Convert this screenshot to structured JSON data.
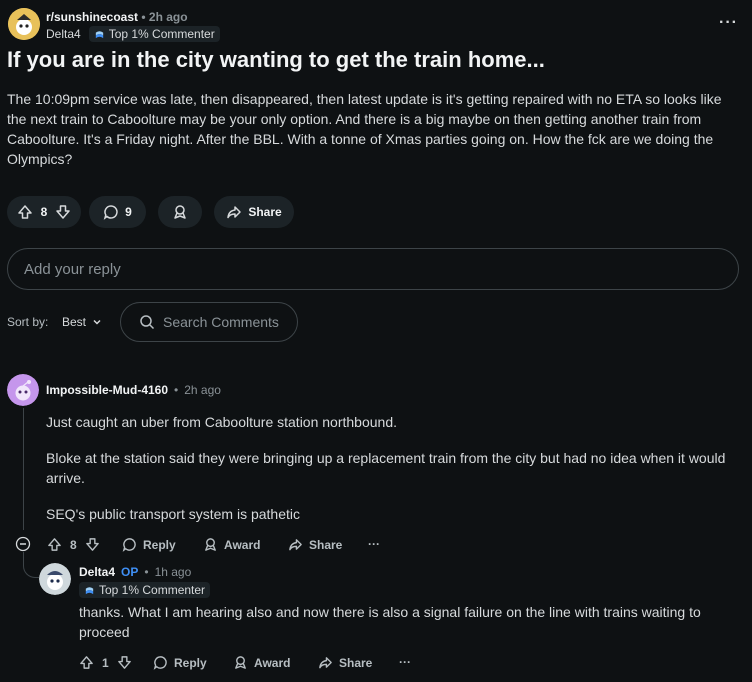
{
  "post": {
    "subreddit": "r/sunshinecoast",
    "separator": "•",
    "time": "2h ago",
    "author": "Delta4",
    "flair": "Top 1% Commenter",
    "more_label": "···",
    "title": "If you are in the city wanting to get the train home...",
    "body": "The 10:09pm service was late, then disappeared, then latest update is it's getting repaired with no ETA so looks like the next train to Caboolture may be your only option. And there is a big maybe on then getting another train from Caboolture. It's a Friday night. After the BBL. With a tonne of Xmas parties going on. How the fck are we doing the Olympics?",
    "votes": "8",
    "comments": "9",
    "share_label": "Share"
  },
  "reply_box": {
    "placeholder": "Add your reply"
  },
  "sort": {
    "label": "Sort by:",
    "value": "Best"
  },
  "search": {
    "placeholder": "Search Comments"
  },
  "comments": [
    {
      "author": "Impossible-Mud-4160",
      "separator": "•",
      "time": "2h ago",
      "paragraphs": [
        "Just caught an uber from Caboolture station northbound.",
        "Bloke at the station said they were bringing up a replacement train from the city but had no idea when it would arrive.",
        "SEQ's public transport system is pathetic"
      ],
      "votes": "8",
      "reply_label": "Reply",
      "award_label": "Award",
      "share_label": "Share",
      "more_label": "···"
    },
    {
      "author": "Delta4",
      "op_label": "OP",
      "separator": "•",
      "time": "1h ago",
      "flair": "Top 1% Commenter",
      "text": "thanks. What I am hearing also and now there is also a signal failure on the line with trains waiting to proceed",
      "votes": "1",
      "reply_label": "Reply",
      "award_label": "Award",
      "share_label": "Share",
      "more_label": "···"
    }
  ],
  "colors": {
    "background": "#0e1113",
    "pill": "#1c2327",
    "op_blue": "#3f8ff5",
    "avatar_purple": "#c596ec",
    "subreddit_yellow": "#e8c15a"
  }
}
